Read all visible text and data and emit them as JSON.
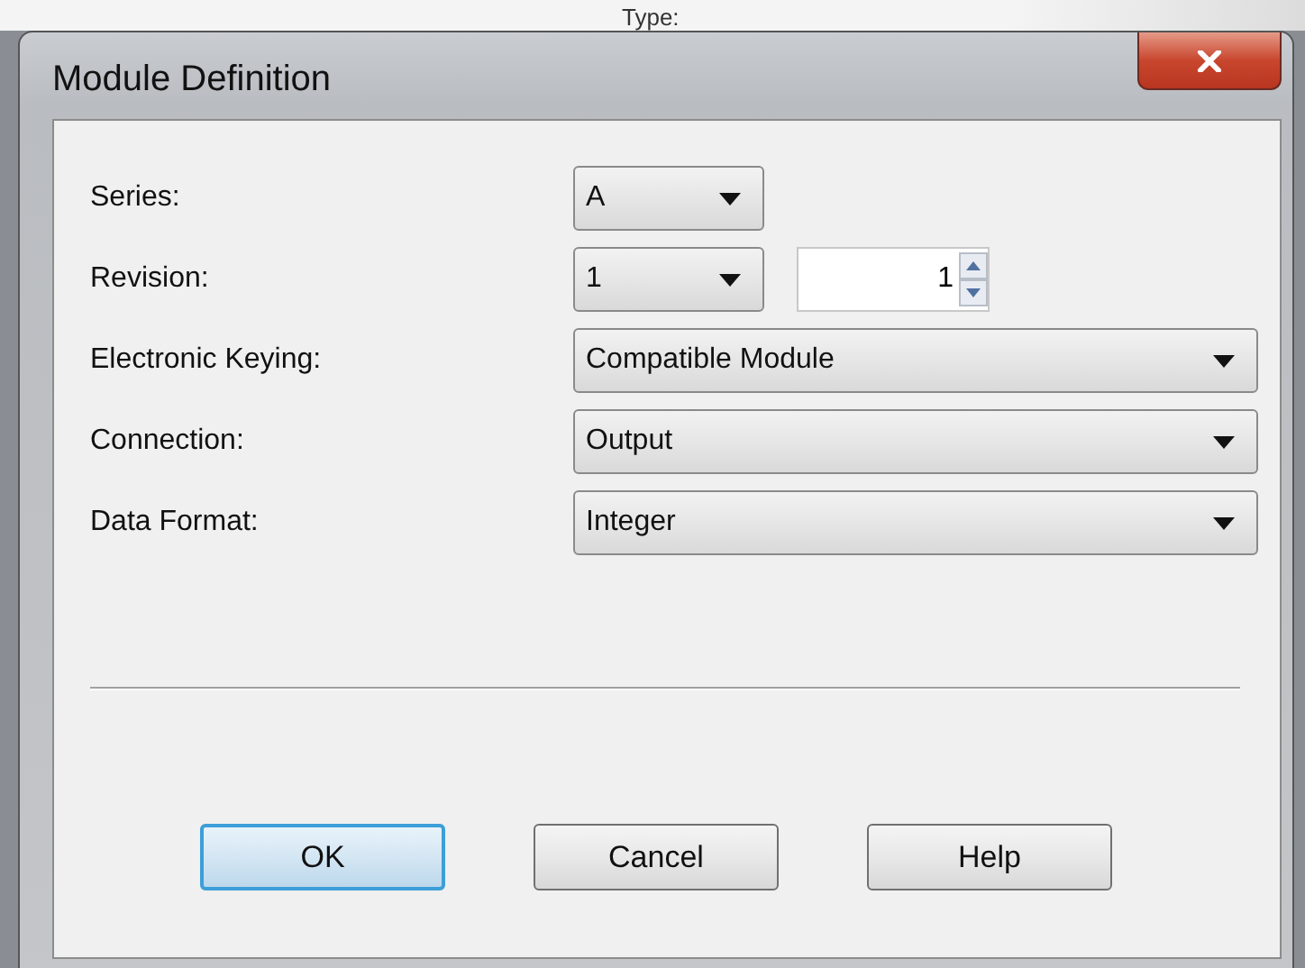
{
  "background": {
    "label": "Type:"
  },
  "window": {
    "title": "Module Definition"
  },
  "fields": [
    {
      "label": "Series:",
      "kind": "short-dropdown",
      "value": "A"
    },
    {
      "label": "Revision:",
      "kind": "dropdown-spinner",
      "value": "1",
      "spinner_value": "1"
    },
    {
      "label": "Electronic Keying:",
      "kind": "wide-dropdown",
      "value": "Compatible Module"
    },
    {
      "label": "Connection:",
      "kind": "wide-dropdown",
      "value": "Output"
    },
    {
      "label": "Data Format:",
      "kind": "wide-dropdown",
      "value": "Integer"
    }
  ],
  "buttons": [
    {
      "label": "OK",
      "focused": true
    },
    {
      "label": "Cancel",
      "focused": false
    },
    {
      "label": "Help",
      "focused": false
    }
  ]
}
